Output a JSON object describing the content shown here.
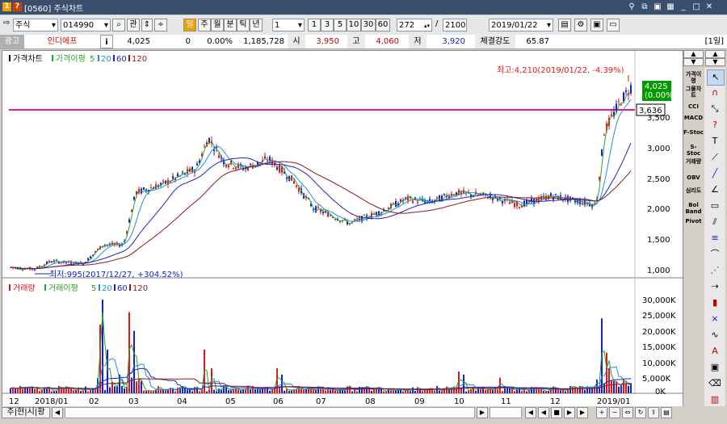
{
  "window": {
    "code": "[0560]",
    "title": "주식차트"
  },
  "toolbar": {
    "market": "주식",
    "stock_code": "014990",
    "search_label": "관",
    "periods": [
      "주",
      "월",
      "분",
      "틱",
      "년"
    ],
    "count": "1",
    "minutes": [
      "1",
      "3",
      "5",
      "10",
      "30",
      "60"
    ],
    "bars_display": "272",
    "bars_total": "2100",
    "date": "2019/01/22"
  },
  "info": {
    "ad_label": "광고",
    "stock_name": "인디에프",
    "info_icon": "i",
    "price": "4,025",
    "change": "0",
    "change_pct": "0.00%",
    "volume": "1,185,728",
    "open_label": "시",
    "open": "3,950",
    "high_label": "고",
    "high": "4,060",
    "low_label": "저",
    "low": "3,920",
    "strength_label": "체결강도",
    "strength": "65.87",
    "period_badge": "[1일]"
  },
  "price_chart": {
    "legend": {
      "name": "가격차트",
      "ma_label": "가격이평",
      "ma": [
        "5",
        "20",
        "60",
        "120"
      ]
    },
    "max_annotation": "최고:4,210(2019/01/22, -4.39%)",
    "min_annotation": "최저:995(2017/12/27, +304.52%)",
    "current_price": "4,025",
    "current_pct": "(0.00%)",
    "line_label": "3,636",
    "y_ticks": [
      "3,500",
      "3,000",
      "2,500",
      "2,000",
      "1,500",
      "1,000"
    ]
  },
  "volume_chart": {
    "legend": {
      "name": "거래량",
      "ma_label": "거래이평",
      "ma": [
        "5",
        "20",
        "60",
        "120"
      ]
    },
    "y_ticks": [
      "30,000K",
      "25,000K",
      "20,000K",
      "15,000K",
      "10,000K",
      "5,000K",
      "0K"
    ]
  },
  "x_axis": [
    "12",
    "2018/01",
    "02",
    "03",
    "04",
    "05",
    "06",
    "07",
    "08",
    "09",
    "10",
    "11",
    "12",
    "2019/01"
  ],
  "side_indicators": [
    "가격이평",
    "그물차트",
    "CCI",
    "MACD",
    "F-Stoc",
    "S-Stoc",
    "거래량",
    "OBV",
    "심리도",
    "Bol Band",
    "Pivot"
  ],
  "status": {
    "left_label": "주|현|시|황"
  },
  "colors": {
    "up": "#e8131a",
    "down": "#1423c8",
    "ma5": "#2ca02c",
    "ma20": "#1e90d6",
    "ma60": "#1f23c0",
    "ma120": "#8b1a1a",
    "hline": "#e2178a",
    "title_bg": "#3a4f6e"
  }
}
